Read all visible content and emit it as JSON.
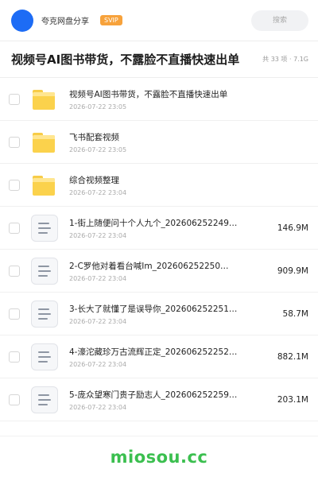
{
  "header": {
    "owner_name": "夸克网盘分享",
    "vip_badge": "SVIP",
    "search_placeholder": "搜索"
  },
  "folder": {
    "title": "视频号AI图书带货，不露脸不直播快速出单",
    "meta": "共 33 项 · 7.1G"
  },
  "items": [
    {
      "type": "folder",
      "name": "视频号AI图书带货，不露脸不直播快速出单",
      "date": "2026-07-22 23:05",
      "size": ""
    },
    {
      "type": "folder",
      "name": "飞书配套视频",
      "date": "2026-07-22 23:05",
      "size": ""
    },
    {
      "type": "folder",
      "name": "综合视频整理",
      "date": "2026-07-22 23:04",
      "size": ""
    },
    {
      "type": "file",
      "name": "1-街上随便问十个人九个_20260625224​9…",
      "date": "2026-07-22 23:04",
      "size": "146.9M"
    },
    {
      "type": "file",
      "name": "2-C罗他对着看台喊Im_202606252250…",
      "date": "2026-07-22 23:04",
      "size": "909.9M"
    },
    {
      "type": "file",
      "name": "3-长大了就懂了是误导你_202606252251…",
      "date": "2026-07-22 23:04",
      "size": "58.7M"
    },
    {
      "type": "file",
      "name": "4-濠沱藏珍万古流辉正定_202606252252…",
      "date": "2026-07-22 23:04",
      "size": "882.1M"
    },
    {
      "type": "file",
      "name": "5-庞众望寒门贵子励志人_202606252259…",
      "date": "2026-07-22 23:04",
      "size": "203.1M"
    }
  ],
  "watermark": "miosou.cc",
  "colors": {
    "avatar": "#1d6cf5",
    "vip_badge": "#f7a23b",
    "folder": "#fbd24c",
    "watermark": "#3bbf4f"
  }
}
